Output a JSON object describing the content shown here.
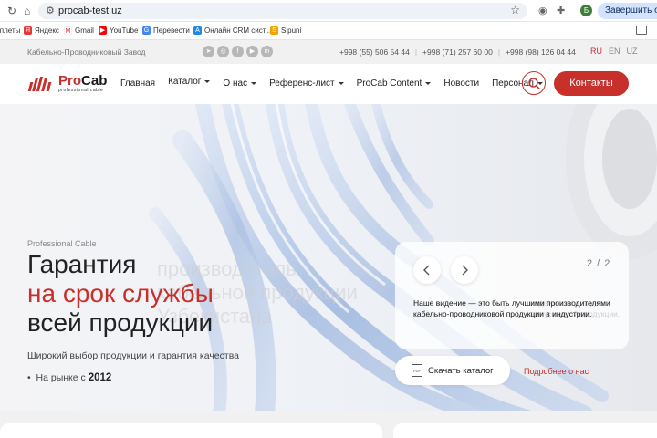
{
  "browser": {
    "url": "procab-test.uz",
    "finish_update": "Завершить обно",
    "avatar_letter": "Б"
  },
  "bookmarks": [
    {
      "label": "Сплеты",
      "icon": ""
    },
    {
      "label": "Яндекс",
      "icon": "Я"
    },
    {
      "label": "Gmail",
      "icon": "M"
    },
    {
      "label": "YouTube",
      "icon": "▶"
    },
    {
      "label": "Перевести",
      "icon": "G"
    },
    {
      "label": "Онлайн CRM сист...",
      "icon": "A"
    },
    {
      "label": "Sipuni",
      "icon": "S"
    }
  ],
  "topbar": {
    "plant": "Кабельно-Проводниковый Завод",
    "phones": [
      "+998 (55) 506 54 44",
      "+998 (71) 257 60 00",
      "+998 (98) 126 04 44"
    ],
    "langs": [
      "RU",
      "EN",
      "UZ"
    ]
  },
  "logo": {
    "pro": "Pro",
    "cab": "Cab",
    "tagline": "professional cable"
  },
  "menu": [
    {
      "label": "Главная",
      "dropdown": false
    },
    {
      "label": "Каталог",
      "dropdown": true
    },
    {
      "label": "О нас",
      "dropdown": true
    },
    {
      "label": "Референс-лист",
      "dropdown": true
    },
    {
      "label": "ProCab Content",
      "dropdown": true
    },
    {
      "label": "Новости",
      "dropdown": false
    },
    {
      "label": "Персонал",
      "dropdown": true
    }
  ],
  "contact_label": "Контакты",
  "hero": {
    "kicker": "Professional Cable",
    "line1": "Гарантия",
    "line2": "на срок службы",
    "line3": "всей продукции",
    "ghost1": "производитель",
    "ghost2": "кабельной продукции",
    "ghost3": "Узбекистана",
    "subtitle": "Широкий выбор продукции и гарантия качества",
    "market_prefix": "На рынке с",
    "market_year": "2012",
    "counter": "2 / 2",
    "vision": "Наше видение — это быть лучшими производителями кабельно-проводниковой продукции в индустрии.",
    "vision_ghost": "надежности в лидер выпускаемой продукции.",
    "catalog_label": "Скачать каталог",
    "pdf_label": "PDF",
    "more_label": "Подробнее о нас"
  },
  "colors": {
    "accent": "#c8302c",
    "hero_bg": "#f4f4f6",
    "cable": "#b9cbe6"
  }
}
